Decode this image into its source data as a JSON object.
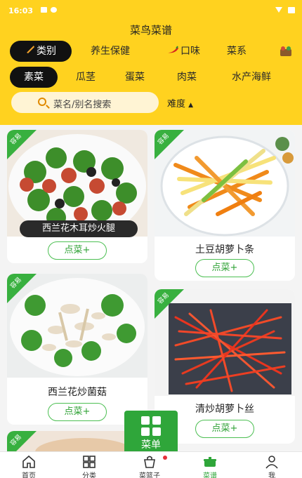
{
  "status_bar": {
    "time": "16:03"
  },
  "app": {
    "title": "菜鸟菜谱"
  },
  "category_tabs": [
    {
      "label": "类别",
      "active": true
    },
    {
      "label": "养生保健"
    },
    {
      "label": "口味"
    },
    {
      "label": "菜系"
    }
  ],
  "sub_tabs": [
    {
      "label": "素菜",
      "active": true
    },
    {
      "label": "瓜茎"
    },
    {
      "label": "蛋菜"
    },
    {
      "label": "肉菜"
    },
    {
      "label": "水产海鲜"
    }
  ],
  "search": {
    "placeholder": "菜名/别名搜索"
  },
  "filters": {
    "difficulty_label": "难度"
  },
  "recipes": [
    {
      "name": "西兰花木耳炒火腿",
      "badge": "容易",
      "button": "点菜+"
    },
    {
      "name": "土豆胡萝卜条",
      "badge": "容易",
      "button": "点菜+"
    },
    {
      "name": "西兰花炒菌菇",
      "badge": "容易",
      "button": "点菜+"
    },
    {
      "name": "清炒胡萝卜丝",
      "badge": "容易",
      "button": "点菜+"
    },
    {
      "name": "",
      "badge": "容易"
    }
  ],
  "fab": {
    "label": "菜单"
  },
  "bottom_nav": [
    {
      "label": "首页",
      "icon": "home-icon"
    },
    {
      "label": "分类",
      "icon": "category-icon"
    },
    {
      "label": "菜篮子",
      "icon": "basket-icon"
    },
    {
      "label": "菜谱",
      "icon": "recipe-pot-icon",
      "active": true
    },
    {
      "label": "我",
      "icon": "user-icon"
    }
  ],
  "colors": {
    "header": "#ffd21f",
    "accent_green": "#2fa63a",
    "active_tab": "#111111"
  }
}
